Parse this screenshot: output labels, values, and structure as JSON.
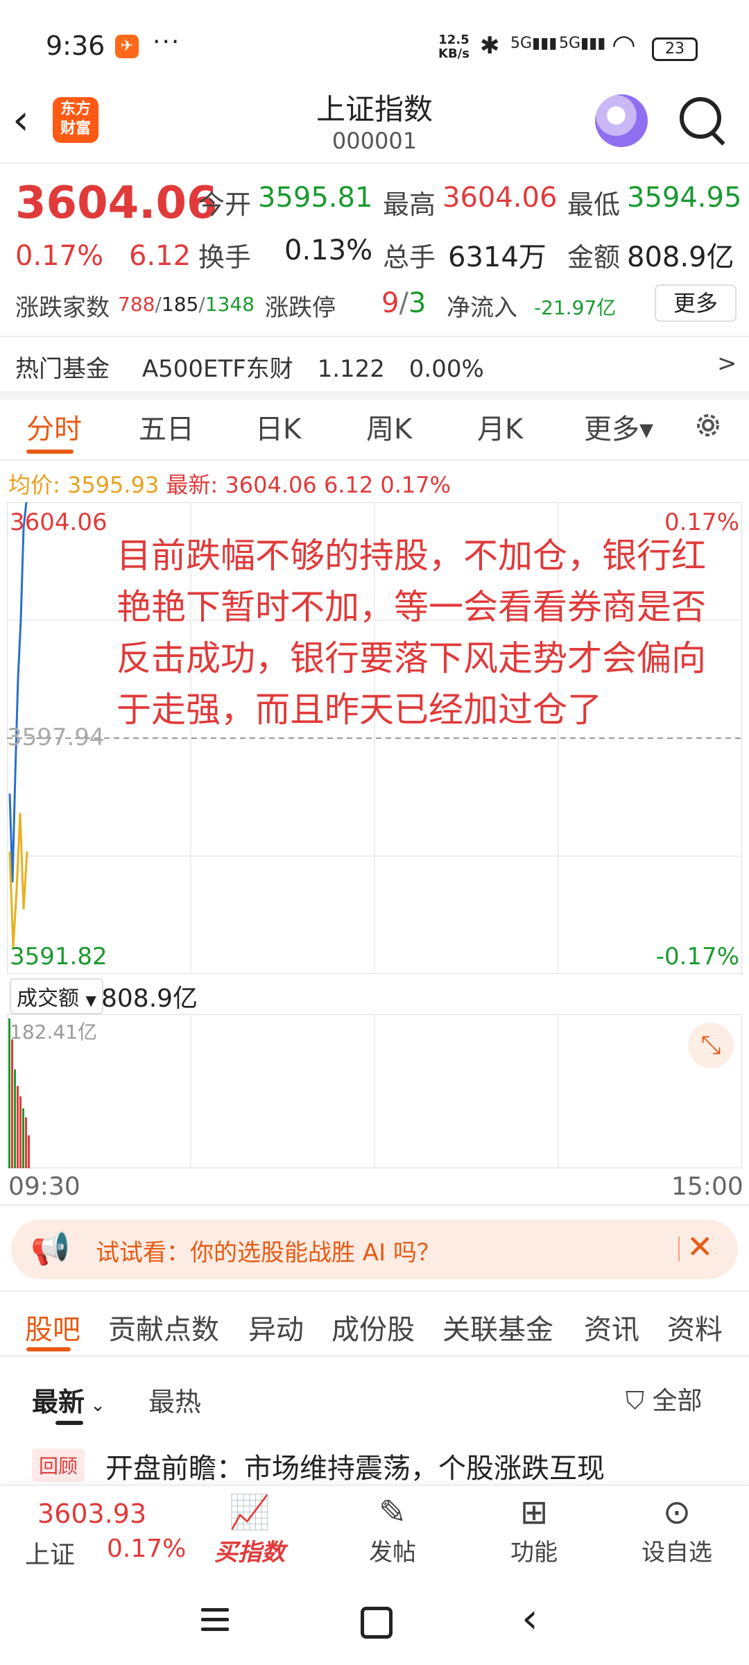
{
  "status_bar": {
    "time": "9:36",
    "net_speed": "12.5",
    "net_unit": "KB/s",
    "signal1": "5G",
    "signal2": "5G",
    "battery": "23"
  },
  "header": {
    "title": "上证指数",
    "code": "000001",
    "logo_text": "东方财富"
  },
  "quote": {
    "price": "3604.06",
    "change_pct": "0.17%",
    "change_val": "6.12",
    "open_label": "今开",
    "open": "3595.81",
    "high_label": "最高",
    "high": "3604.06",
    "low_label": "最低",
    "low": "3594.95",
    "turnover_label": "换手",
    "turnover": "0.13%",
    "volume_label": "总手",
    "volume": "6314万",
    "amount_label": "金额",
    "amount": "808.9亿",
    "breadth_label": "涨跌家数",
    "breadth_up": "788",
    "breadth_flat": "185",
    "breadth_down": "1348",
    "limit_label": "涨跌停",
    "limit_up": "9",
    "limit_down": "3",
    "netflow_label": "净流入",
    "netflow": "-21.97亿",
    "more_label": "更多"
  },
  "hot_fund": {
    "label": "热门基金",
    "name": "A500ETF东财",
    "price": "1.122",
    "change": "0.00%",
    "arrow": ">"
  },
  "chart_tabs": [
    "分时",
    "五日",
    "日K",
    "周K",
    "月K",
    "更多▾"
  ],
  "avg_line": {
    "avg_label": "均价:",
    "avg_value": "3595.93",
    "latest_label": "最新:",
    "latest_value": "3604.06",
    "latest_change": "6.12",
    "latest_pct": "0.17%"
  },
  "chart_data": {
    "type": "line",
    "y_top_label": "3604.06",
    "y_mid_label": "3597.94",
    "y_bottom_label": "3591.82",
    "pct_top_label": "0.17%",
    "pct_bottom_label": "-0.17%",
    "ylim": [
      3591.82,
      3604.06
    ],
    "x_start": "09:30",
    "x_end": "15:00",
    "series": [
      {
        "values": [
          3596.5,
          3594.2,
          3597.0,
          3599.5,
          3601.0,
          3603.4,
          3604.06
        ]
      },
      {
        "values": [
          3595.0,
          3592.5,
          3594.0,
          3596.0,
          3593.5,
          3595.0
        ]
      }
    ]
  },
  "annotation": "目前跌幅不够的持股，不加仓，银行红艳艳下暂时不加，等一会看看券商是否反击成功，银行要落下风走势才会偏向于走强，而且昨天已经加过仓了",
  "volume": {
    "select_label": "成交额",
    "value": "808.9亿",
    "max_label": "182.41亿",
    "bars": [
      {
        "v": 1.0,
        "c": "#1a9a2e"
      },
      {
        "v": 0.86,
        "c": "#e03a3a"
      },
      {
        "v": 0.66,
        "c": "#1a9a2e"
      },
      {
        "v": 0.55,
        "c": "#e03a3a"
      },
      {
        "v": 0.48,
        "c": "#e03a3a"
      },
      {
        "v": 0.4,
        "c": "#1a9a2e"
      },
      {
        "v": 0.34,
        "c": "#e03a3a"
      },
      {
        "v": 0.22,
        "c": "#e03a3a"
      }
    ]
  },
  "promo": {
    "text": "试试看：你的选股能战胜 AI 吗？"
  },
  "section_tabs": [
    "股吧",
    "贡献点数",
    "异动",
    "成份股",
    "关联基金",
    "资讯",
    "资料"
  ],
  "sort": {
    "newest": "最新",
    "hottest": "最热",
    "filter": "全部"
  },
  "post": {
    "tag": "回顾",
    "title": "开盘前瞻：市场维持震荡，个股涨跌互现"
  },
  "bottom_bar": {
    "price": "3603.93",
    "name": "上证",
    "pct": "0.17%",
    "items": [
      "买指数",
      "发帖",
      "功能",
      "设自选"
    ]
  }
}
